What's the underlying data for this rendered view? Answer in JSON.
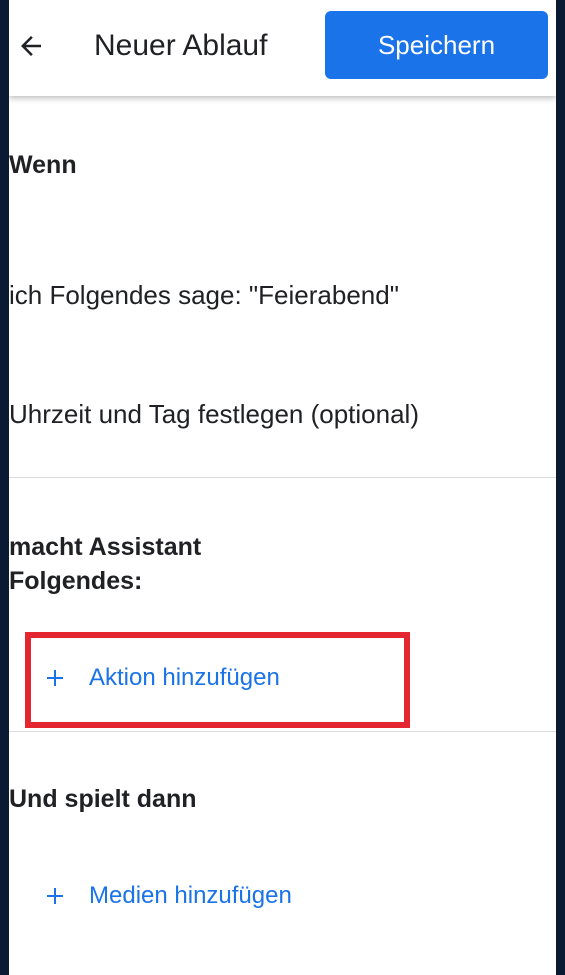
{
  "header": {
    "title": "Neuer Ablauf",
    "save_label": "Speichern",
    "back_icon": "arrow-back-icon"
  },
  "when_section": {
    "heading": "Wenn",
    "trigger_phrase": "ich Folgendes sage: \"Feierabend\"",
    "schedule": "Uhrzeit und Tag festlegen (optional)"
  },
  "actions_section": {
    "heading": "macht Assistant Folgendes:",
    "add_action": "Aktion hinzufügen",
    "add_icon": "plus-icon"
  },
  "media_section": {
    "heading": "Und spielt dann",
    "add_media": "Medien hinzufügen",
    "add_icon": "plus-icon"
  },
  "colors": {
    "accent": "#1a73e8",
    "highlight": "#e3262f",
    "text": "#202124",
    "background_frame": "#0b1a33"
  }
}
